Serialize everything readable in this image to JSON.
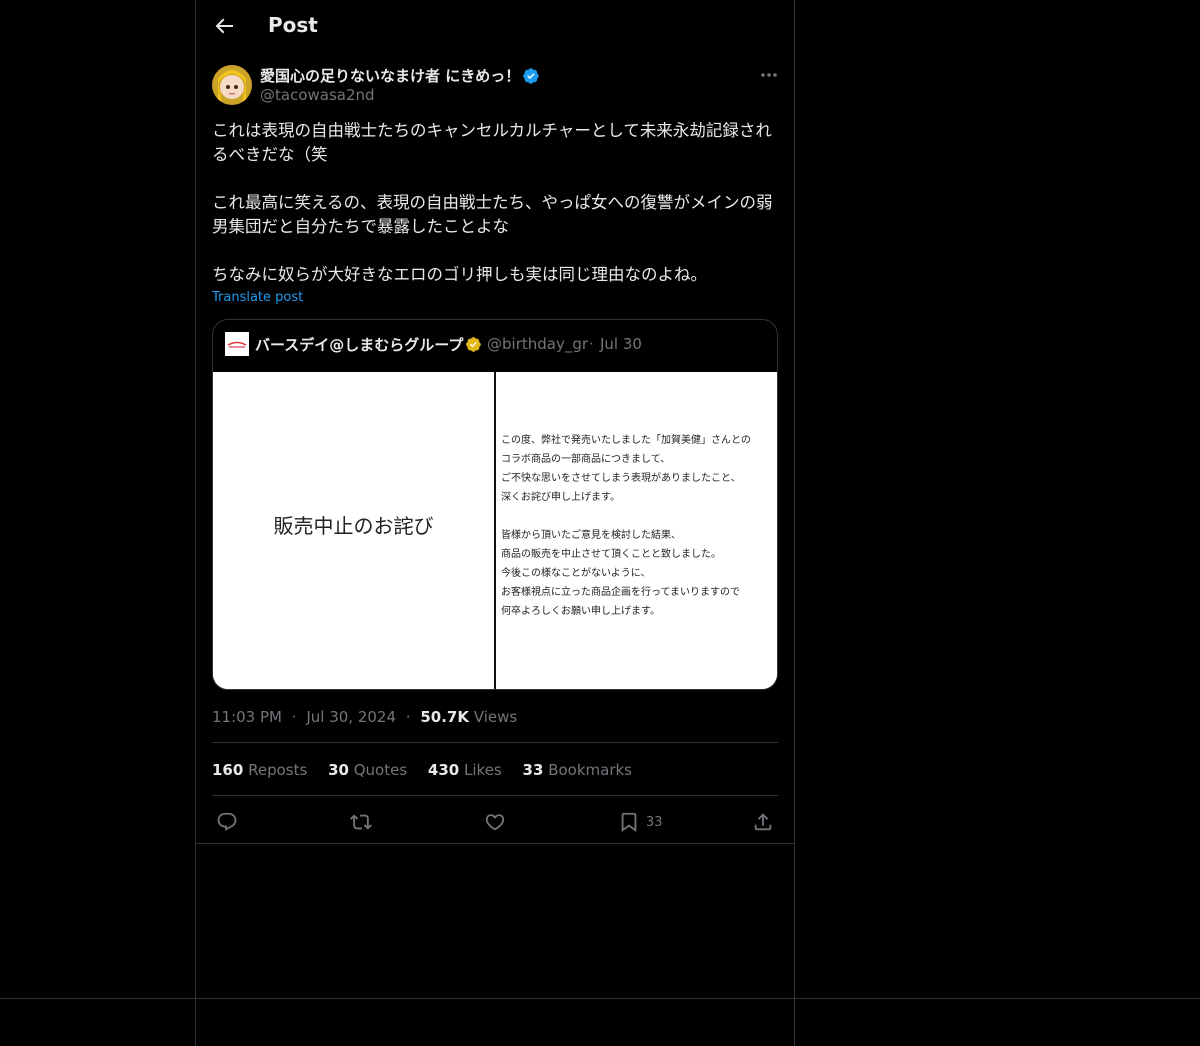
{
  "header": {
    "title": "Post"
  },
  "author": {
    "name": "愛国心の足りないなまけ者 にきめっ！",
    "handle": "@tacowasa2nd"
  },
  "post": {
    "text": "これは表現の自由戦士たちのキャンセルカルチャーとして未来永劫記録されるべきだな（笑\n\nこれ最高に笑えるの、表現の自由戦士たち、やっぱ女への復讐がメインの弱男集団だと自分たちで暴露したことよな\n\nちなみに奴らが大好きなエロのゴリ押しも実は同じ理由なのよね。",
    "translate_label": "Translate post"
  },
  "quote": {
    "logo_text": "バースデイ",
    "name": "バースデイ@しまむらグループ",
    "handle": "@birthday_gr",
    "separator": "·",
    "date": "Jul 30",
    "image_left_heading": "販売中止のお詫び",
    "image_right_para1": "この度、弊社で発売いたしました「加賀美健」さんとの\nコラボ商品の一部商品につきまして、\nご不快な思いをさせてしまう表現がありましたこと、\n深くお詫び申し上げます。",
    "image_right_para2": "皆様から頂いたご意見を検討した結果、\n商品の販売を中止させて頂くことと致しました。\n今後この様なことがないように、\nお客様視点に立った商品企画を行ってまいりますので\n何卒よろしくお願い申し上げます。"
  },
  "meta": {
    "time": "11:03 PM",
    "separator1": "·",
    "date": "Jul 30, 2024",
    "separator2": "·",
    "views_count": "50.7K",
    "views_label": "Views"
  },
  "stats": {
    "reposts_count": "160",
    "reposts_label": "Reposts",
    "quotes_count": "30",
    "quotes_label": "Quotes",
    "likes_count": "430",
    "likes_label": "Likes",
    "bookmarks_count": "33",
    "bookmarks_label": "Bookmarks"
  },
  "actions": {
    "bookmark_count": "33"
  },
  "colors": {
    "background": "#000000",
    "text": "#e7e9ea",
    "secondary": "#71767b",
    "link": "#1d9bf0",
    "border": "#2f3336",
    "verified_blue": "#1d9bf0",
    "verified_gold": "#e2b719"
  },
  "icons": [
    "back-arrow-icon",
    "verified-icon",
    "more-icon",
    "gold-verified-icon",
    "reply-icon",
    "repost-icon",
    "like-icon",
    "bookmark-icon",
    "share-icon"
  ]
}
